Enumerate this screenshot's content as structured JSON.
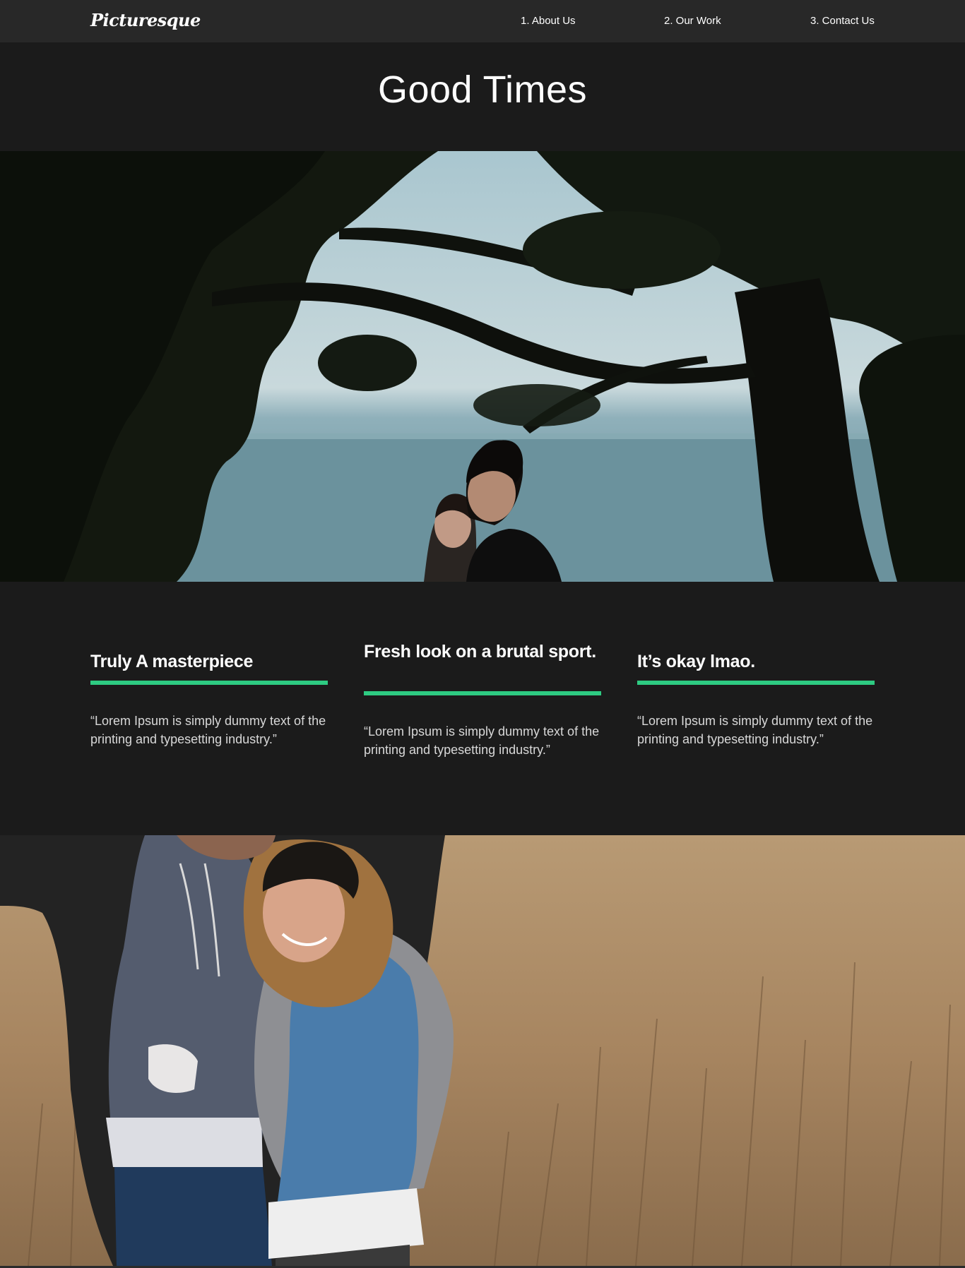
{
  "navbar": {
    "brand": "Picturesque",
    "links": [
      {
        "label": "1. About Us"
      },
      {
        "label": "2. Our Work"
      },
      {
        "label": "3. Contact Us"
      }
    ]
  },
  "hero": {
    "title": "Good Times"
  },
  "features": [
    {
      "heading": "Truly A masterpiece",
      "text": "“Lorem Ipsum is simply dummy text of the printing and typesetting industry.”"
    },
    {
      "heading": "Fresh look on a brutal sport.",
      "text": "“Lorem Ipsum is simply dummy text of the printing and typesetting industry.”"
    },
    {
      "heading": "It’s okay lmao.",
      "text": "“Lorem Ipsum is simply dummy text of the printing and typesetting industry.”"
    }
  ],
  "colors": {
    "navbar_bg": "#282828",
    "page_bg": "#1b1b1b",
    "accent_underline": "#2ecb82",
    "body_text": "#d8d8d8"
  }
}
